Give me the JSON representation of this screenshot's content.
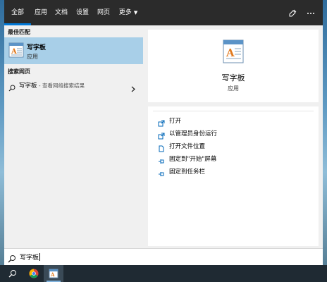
{
  "tabs": [
    {
      "label": "全部",
      "active": true
    },
    {
      "label": "应用"
    },
    {
      "label": "文档"
    },
    {
      "label": "设置"
    },
    {
      "label": "网页"
    },
    {
      "label": "更多"
    }
  ],
  "left": {
    "best_match_title": "最佳匹配",
    "best_match": {
      "name": "写字板",
      "type": "应用",
      "icon": "wordpad-icon"
    },
    "web_title": "搜索网页",
    "web_result": {
      "query": "写字板",
      "suffix": " - 查看网络搜索结果"
    }
  },
  "detail": {
    "name": "写字板",
    "type": "应用",
    "icon": "wordpad-icon"
  },
  "actions": [
    {
      "label": "打开",
      "icon": "open-icon"
    },
    {
      "label": "以管理员身份运行",
      "icon": "run-as-admin-icon"
    },
    {
      "label": "打开文件位置",
      "icon": "file-location-icon"
    },
    {
      "label": "固定到\"开始\"屏幕",
      "icon": "pin-icon"
    },
    {
      "label": "固定到任务栏",
      "icon": "pin-icon"
    }
  ],
  "search": {
    "value": "写字板"
  },
  "colors": {
    "accent": "#0078d7",
    "selection": "#a8cfe8",
    "topbar": "#2b2b2b"
  }
}
